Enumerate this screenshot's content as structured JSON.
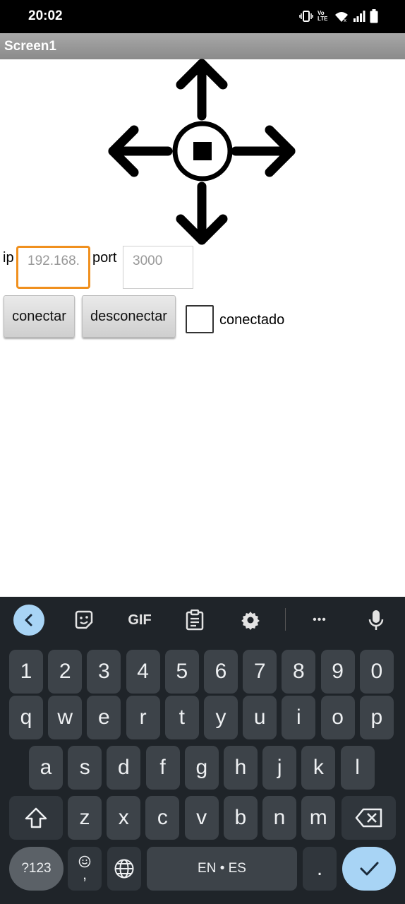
{
  "status_bar": {
    "time": "20:02",
    "icons": [
      "vibrate-icon",
      "volte-icon",
      "wifi-icon",
      "signal-icon",
      "battery-icon"
    ],
    "volte_text": "Vo LTE"
  },
  "app": {
    "title": "Screen1",
    "dpad": {
      "icons": [
        "arrow-up-icon",
        "arrow-left-icon",
        "stop-icon",
        "arrow-right-icon",
        "arrow-down-icon"
      ],
      "color": "#000000"
    },
    "ip_label": "ip",
    "ip_value": "192.168.",
    "port_label": "port",
    "port_value": "3000",
    "connect_button": "conectar",
    "disconnect_button": "desconectar",
    "connected_label": "conectado",
    "connected_checked": false,
    "focus_color": "#f0901e"
  },
  "keyboard": {
    "toolbar": [
      "back-icon",
      "sticker-icon",
      "gif-icon",
      "clipboard-icon",
      "settings-icon",
      "more-icon",
      "mic-icon"
    ],
    "gif_label": "GIF",
    "more_label": "•••",
    "row_numbers": [
      "1",
      "2",
      "3",
      "4",
      "5",
      "6",
      "7",
      "8",
      "9",
      "0"
    ],
    "row_top": [
      "q",
      "w",
      "e",
      "r",
      "t",
      "y",
      "u",
      "i",
      "o",
      "p"
    ],
    "row_mid": [
      "a",
      "s",
      "d",
      "f",
      "g",
      "h",
      "j",
      "k",
      "l"
    ],
    "row_bottom": [
      "z",
      "x",
      "c",
      "v",
      "b",
      "n",
      "m"
    ],
    "symbols_key": "?123",
    "emoji_comma_key": ",",
    "space_label": "EN • ES",
    "period_key": ".",
    "accent_color": "#a8d4f5",
    "background_color": "#1f2429"
  }
}
